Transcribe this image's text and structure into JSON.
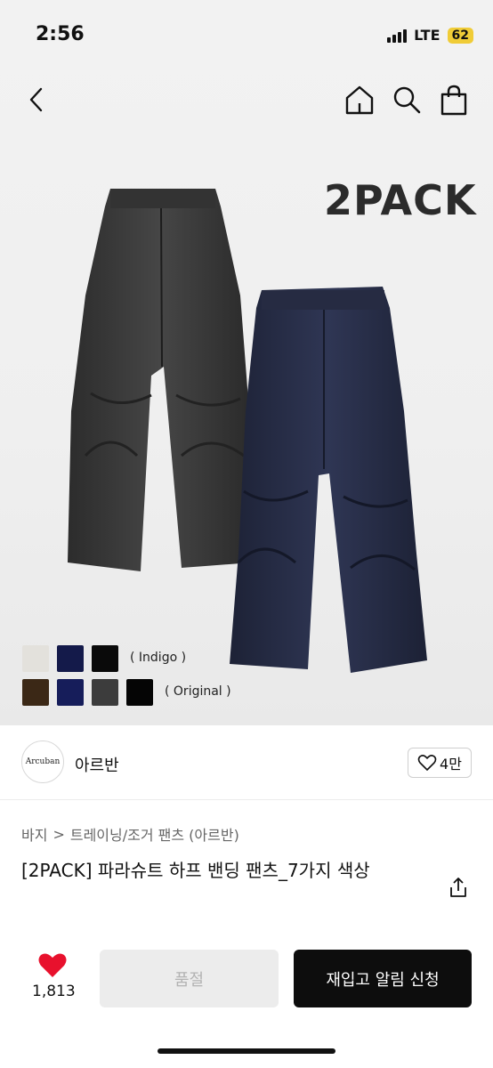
{
  "status_bar": {
    "time": "2:56",
    "network": "LTE",
    "battery": "62",
    "battery_color": "#f0cc37"
  },
  "nav": {
    "back_icon": "chevron-left-icon",
    "home_icon": "home-icon",
    "search_icon": "search-icon",
    "cart_icon": "shopping-bag-icon"
  },
  "product_image": {
    "pack_label": "2PACK",
    "swatch_rows": [
      {
        "note": "( Indigo )",
        "colors": [
          "#e3e1dc",
          "#141a4a",
          "#0a0a0a"
        ]
      },
      {
        "note": "( Original )",
        "colors": [
          "#3b2816",
          "#161d5a",
          "#3c3c3c",
          "#050505"
        ]
      }
    ]
  },
  "brand": {
    "logo_text": "Arcuban",
    "name": "아르반",
    "like_count": "4만"
  },
  "breadcrumb": {
    "items": [
      "바지",
      "트레이닝/조거 팬츠 (아르반)"
    ],
    "separator": ">"
  },
  "product": {
    "title": "[2PACK] 파라슈트 하프 밴딩 팬츠_7가지 색상"
  },
  "actions": {
    "wish_count": "1,813",
    "heart_color": "#e8112d",
    "soldout_label": "품절",
    "restock_label": "재입고 알림 신청"
  }
}
